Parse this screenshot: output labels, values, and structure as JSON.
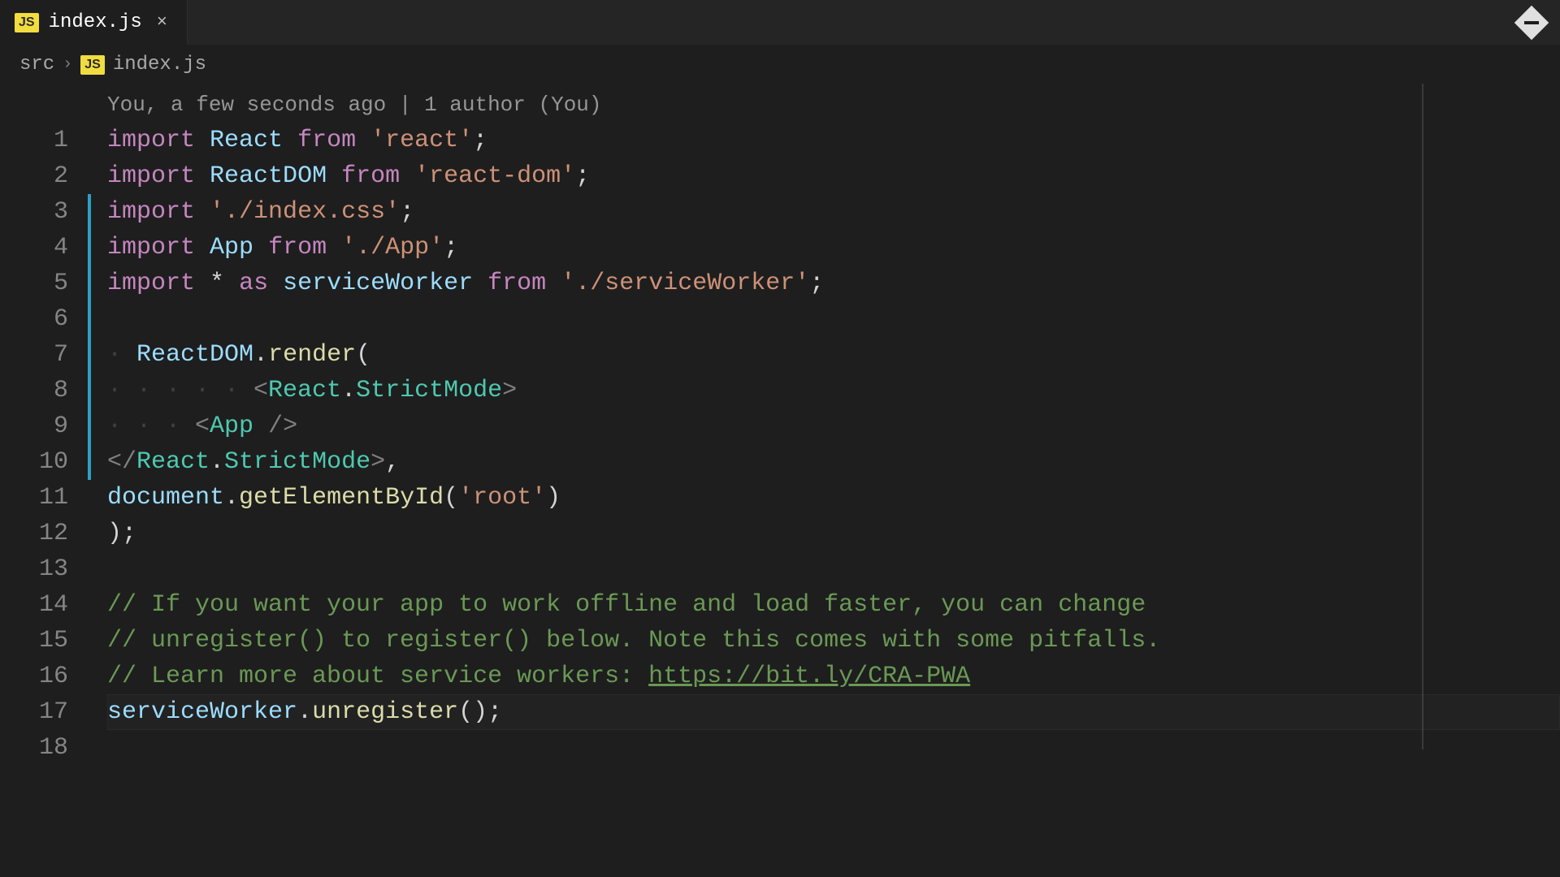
{
  "tab": {
    "filename": "index.js",
    "close": "×"
  },
  "breadcrumb": {
    "folder": "src",
    "file": "index.js"
  },
  "codelens": "You, a few seconds ago | 1 author (You)",
  "gutter": [
    "1",
    "2",
    "3",
    "4",
    "5",
    "6",
    "7",
    "8",
    "9",
    "10",
    "11",
    "12",
    "13",
    "14",
    "15",
    "16",
    "17",
    "18"
  ],
  "code": {
    "l1": {
      "kw": "import",
      "id": "React",
      "from": "from",
      "str": "'react'",
      "end": ";"
    },
    "l2": {
      "kw": "import",
      "id": "ReactDOM",
      "from": "from",
      "str": "'react-dom'",
      "end": ";"
    },
    "l3": {
      "kw": "import",
      "str": "'./index.css'",
      "end": ";"
    },
    "l4": {
      "kw": "import",
      "id": "App",
      "from": "from",
      "str": "'./App'",
      "end": ";"
    },
    "l5": {
      "kw": "import",
      "star": "*",
      "as": "as",
      "id": "serviceWorker",
      "from": "from",
      "str": "'./serviceWorker'",
      "end": ";"
    },
    "l7": {
      "obj": "ReactDOM",
      "dot": ".",
      "fn": "render",
      "open": "("
    },
    "l8": {
      "open": "<",
      "ns": "React",
      "dot": ".",
      "comp": "StrictMode",
      "close": ">"
    },
    "l9": {
      "open": "<",
      "comp": "App",
      "selfclose": " />"
    },
    "l10": {
      "open": "</",
      "ns": "React",
      "dot": ".",
      "comp": "StrictMode",
      "close": ">",
      "comma": ","
    },
    "l11": {
      "obj": "document",
      "dot": ".",
      "fn": "getElementById",
      "open": "(",
      "str": "'root'",
      "close": ")"
    },
    "l12": {
      "close": ");"
    },
    "l14": "// If you want your app to work offline and load faster, you can change",
    "l15": "// unregister() to register() below. Note this comes with some pitfalls.",
    "l16a": "// Learn more about service workers: ",
    "l16b": "https://bit.ly/CRA-PWA",
    "l17": {
      "obj": "serviceWorker",
      "dot": ".",
      "fn": "unregister",
      "call": "();"
    }
  }
}
